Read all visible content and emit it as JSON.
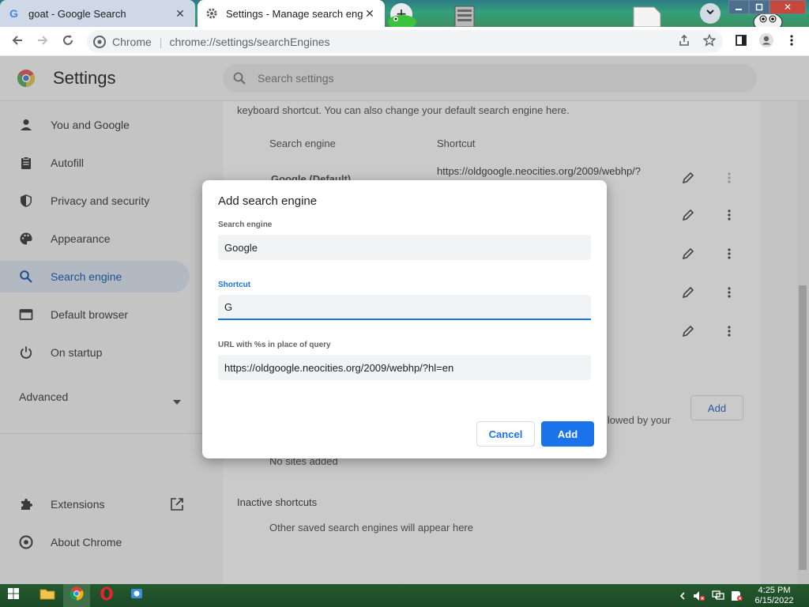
{
  "browser": {
    "tabs": [
      {
        "title": "goat - Google Search",
        "active": false
      },
      {
        "title": "Settings - Manage search engine",
        "active": true
      }
    ],
    "new_tab": "+",
    "omnibox": {
      "site_name": "Chrome",
      "separator": "|",
      "url_scheme": "chrome://",
      "url_path": "settings/searchEngines"
    }
  },
  "settings": {
    "title": "Settings",
    "search_placeholder": "Search settings",
    "nav": [
      {
        "label": "You and Google",
        "icon": "person-icon"
      },
      {
        "label": "Autofill",
        "icon": "clipboard-icon"
      },
      {
        "label": "Privacy and security",
        "icon": "shield-icon"
      },
      {
        "label": "Appearance",
        "icon": "palette-icon"
      },
      {
        "label": "Search engine",
        "icon": "search-icon",
        "selected": true
      },
      {
        "label": "Default browser",
        "icon": "browser-icon"
      },
      {
        "label": "On startup",
        "icon": "power-icon"
      }
    ],
    "advanced": "Advanced",
    "extensions": "Extensions",
    "about": "About Chrome"
  },
  "main": {
    "intro": "keyboard shortcut. You can also change your default search engine here.",
    "col_engine": "Search engine",
    "col_shortcut": "Shortcut",
    "default_engine": "Google (Default)",
    "default_shortcut": "https://oldgoogle.neocities.org/2009/webhp/?",
    "partial_text": "llowed by your",
    "add_label": "Add",
    "no_sites": "No sites added",
    "inactive_heading": "Inactive shortcuts",
    "inactive_text": "Other saved search engines will appear here"
  },
  "dialog": {
    "title": "Add search engine",
    "engine_label": "Search engine",
    "engine_value": "Google",
    "shortcut_label": "Shortcut",
    "shortcut_value": "G",
    "url_label": "URL with %s in place of query",
    "url_value": "https://oldgoogle.neocities.org/2009/webhp/?hl=en",
    "cancel": "Cancel",
    "add": "Add"
  },
  "taskbar": {
    "time": "4:25 PM",
    "date": "6/15/2022"
  },
  "colors": {
    "accent": "#1a73e8",
    "selected_nav_text": "#1f4f8f"
  }
}
